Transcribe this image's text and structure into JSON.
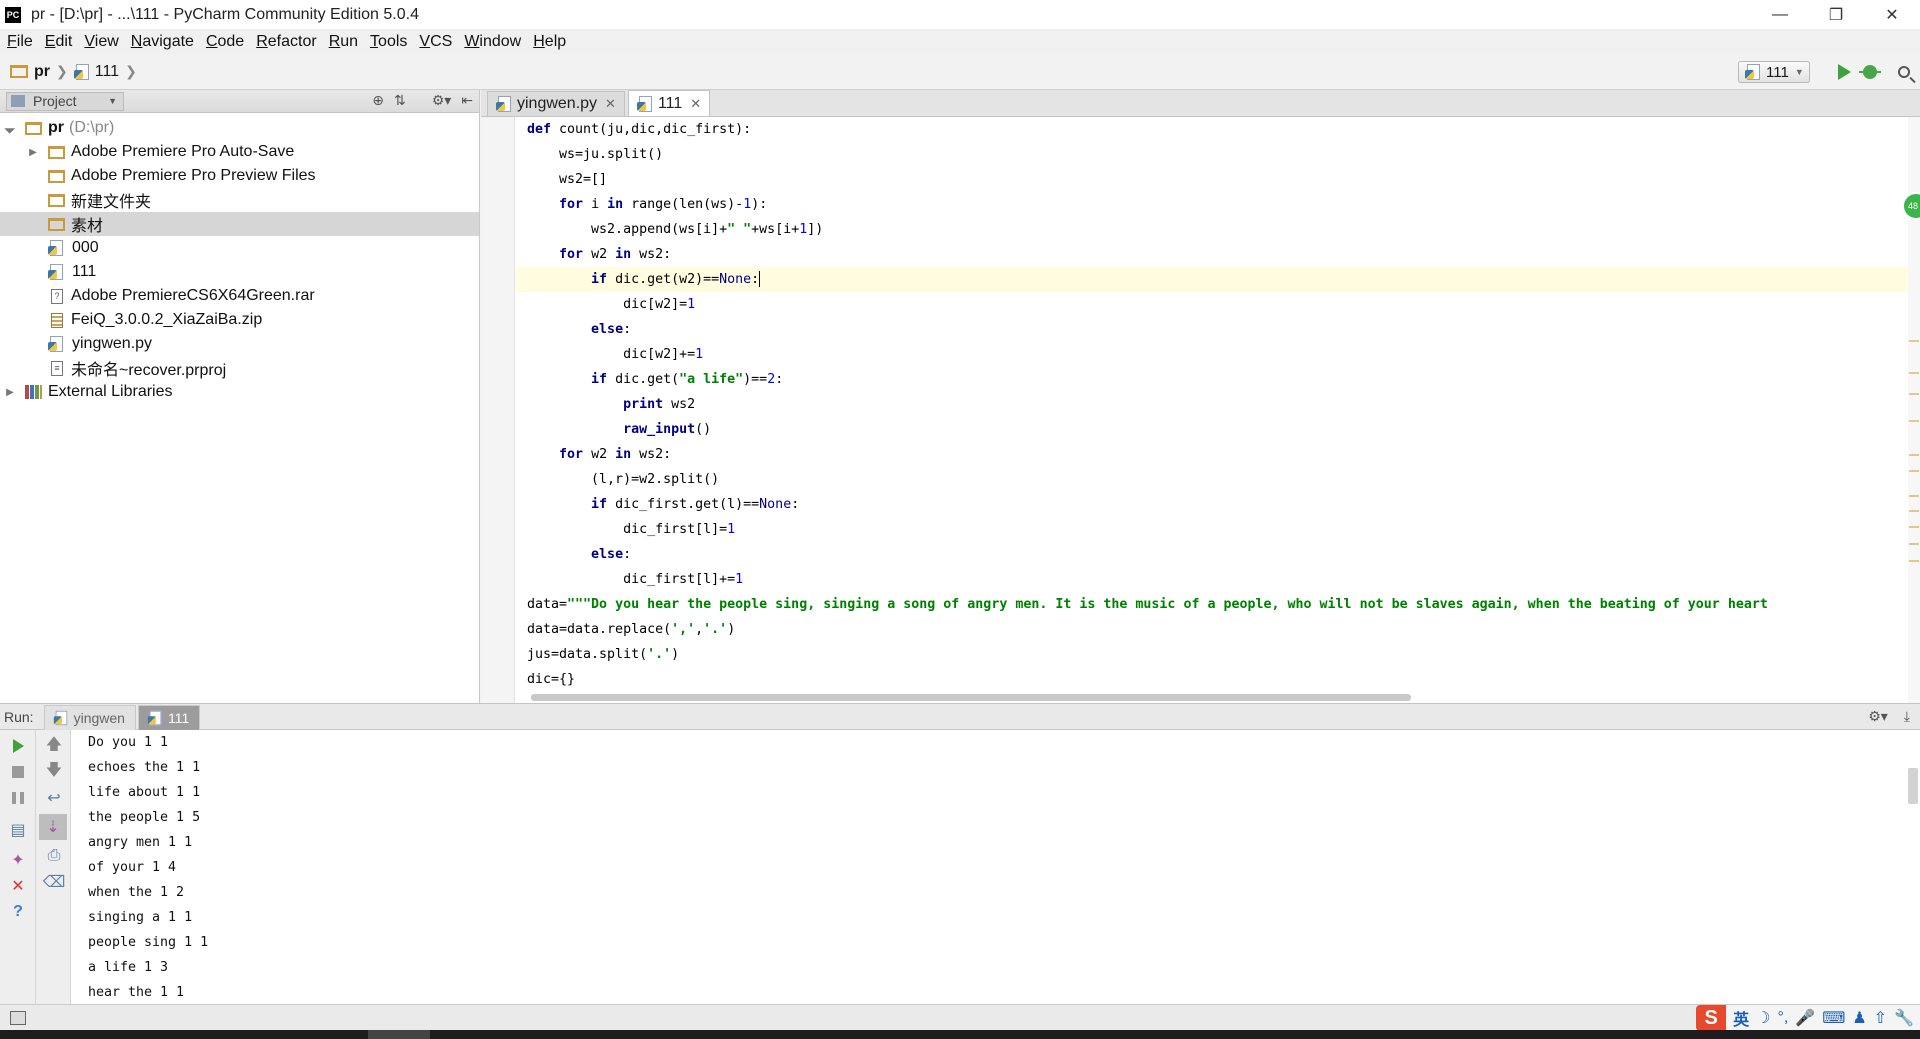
{
  "window": {
    "title": "pr - [D:\\pr] - ...\\111 - PyCharm Community Edition 5.0.4",
    "app_icon": "PC"
  },
  "menu": [
    "File",
    "Edit",
    "View",
    "Navigate",
    "Code",
    "Refactor",
    "Run",
    "Tools",
    "VCS",
    "Window",
    "Help"
  ],
  "breadcrumb": {
    "project": "pr",
    "file": "111"
  },
  "toolbar": {
    "run_config": "111"
  },
  "project_panel": {
    "view_selector": "Project",
    "tree": [
      {
        "label": "pr",
        "suffix": "(D:\\pr)",
        "kind": "folder",
        "depth": 0,
        "expanded": true
      },
      {
        "label": "Adobe Premiere Pro Auto-Save",
        "kind": "folder",
        "depth": 1,
        "collapsed": true
      },
      {
        "label": "Adobe Premiere Pro Preview Files",
        "kind": "folder",
        "depth": 1
      },
      {
        "label": "新建文件夹",
        "kind": "folder",
        "depth": 1
      },
      {
        "label": "素材",
        "kind": "folder",
        "depth": 1,
        "selected": true
      },
      {
        "label": "000",
        "kind": "python",
        "depth": 1
      },
      {
        "label": "111",
        "kind": "python",
        "depth": 1
      },
      {
        "label": "Adobe PremiereCS6X64Green.rar",
        "kind": "unknown",
        "depth": 1
      },
      {
        "label": "FeiQ_3.0.0.2_XiaZaiBa.zip",
        "kind": "archive",
        "depth": 1
      },
      {
        "label": "yingwen.py",
        "kind": "python",
        "depth": 1
      },
      {
        "label": "未命名~recover.prproj",
        "kind": "document",
        "depth": 1
      },
      {
        "label": "External Libraries",
        "kind": "library",
        "depth": 0,
        "collapsed": true
      }
    ]
  },
  "editor": {
    "tabs": [
      {
        "label": "yingwen.py",
        "active": false
      },
      {
        "label": "111",
        "active": true
      }
    ],
    "inspection_badge": "48",
    "lines": [
      "def count(ju,dic,dic_first):",
      "    ws=ju.split()",
      "    ws2=[]",
      "    for i in range(len(ws)-1):",
      "        ws2.append(ws[i]+\" \"+ws[i+1])",
      "    for w2 in ws2:",
      "        if dic.get(w2)==None:",
      "            dic[w2]=1",
      "        else:",
      "            dic[w2]+=1",
      "        if dic.get(\"a life\")==2:",
      "            print ws2",
      "            raw_input()",
      "    for w2 in ws2:",
      "        (l,r)=w2.split()",
      "        if dic_first.get(l)==None:",
      "            dic_first[l]=1",
      "        else:",
      "            dic_first[l]+=1",
      "data=\"\"\"Do you hear the people sing, singing a song of angry men. It is the music of a people, who will not be slaves again, when the beating of your heart",
      "data=data.replace(',','.')",
      "jus=data.split('.')",
      "dic={}"
    ],
    "current_line": 7
  },
  "run_panel": {
    "label": "Run:",
    "tabs": [
      {
        "label": "yingwen",
        "active": false
      },
      {
        "label": "111",
        "active": true
      }
    ],
    "output": [
      "Do you 1 1",
      "echoes the 1 1",
      "life about 1 1",
      "the people 1 5",
      "angry men 1 1",
      "of your 1 4",
      "when the 1 2",
      "singing a 1 1",
      "people sing 1 1",
      "a life 1 3",
      "hear the 1 1"
    ]
  },
  "ime": {
    "logo": "S",
    "mode": "英"
  }
}
